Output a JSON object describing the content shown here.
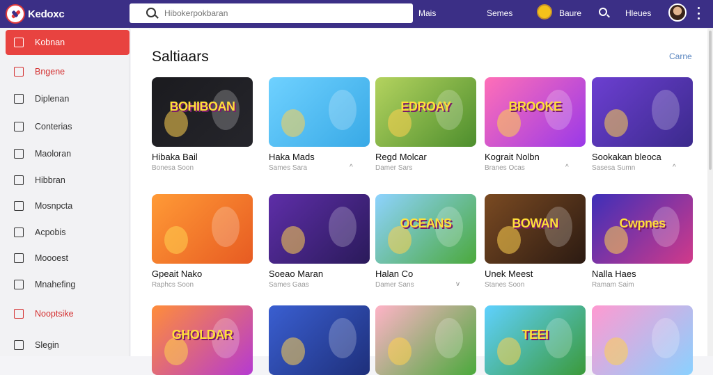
{
  "app": {
    "logo_text": "Kedoxc"
  },
  "search": {
    "placeholder": "Hibokerpokbaran"
  },
  "nav": {
    "link1": "Mais",
    "link2": "Semes",
    "link3": "Baure",
    "link4": "Hleues"
  },
  "sidebar": {
    "items": [
      {
        "label": "Kobnan",
        "icon": "gamepad-icon",
        "state": "active"
      },
      {
        "label": "Bngene",
        "icon": "grid-icon",
        "state": "red"
      },
      {
        "label": "Diplenan",
        "icon": "chat-icon",
        "state": "normal"
      },
      {
        "label": "Conterias",
        "icon": "people-icon",
        "state": "normal"
      },
      {
        "label": "Maoloran",
        "icon": "image-icon",
        "state": "normal"
      },
      {
        "label": "Hibbran",
        "icon": "bag-icon",
        "state": "normal"
      },
      {
        "label": "Mosnpcta",
        "icon": "card-icon",
        "state": "normal"
      },
      {
        "label": "Acpobis",
        "icon": "circle-icon",
        "state": "normal"
      },
      {
        "label": "Moooest",
        "icon": "edit-icon",
        "state": "normal"
      },
      {
        "label": "Mnahefing",
        "icon": "list-icon",
        "state": "normal"
      },
      {
        "label": "Nooptsike",
        "icon": "flag-icon",
        "state": "red"
      },
      {
        "label": "Slegin",
        "icon": "square-icon",
        "state": "normal"
      }
    ]
  },
  "main": {
    "title": "Saltiaars",
    "see_all": "Carne",
    "cards": [
      {
        "title": "Hibaka Bail",
        "sub": "Bonesa Soon",
        "thumb_text": "BOHIBOAN",
        "bg": [
          "#1b1b1f",
          "#25252b"
        ],
        "chev": ""
      },
      {
        "title": "Haka Mads",
        "sub": "Sames Sara",
        "thumb_text": "",
        "bg": [
          "#6fd1ff",
          "#38a9e6"
        ],
        "chev": "^"
      },
      {
        "title": "Regd Molcar",
        "sub": "Damer Sars",
        "thumb_text": "EDROAY",
        "bg": [
          "#b4d35f",
          "#4d8e2d"
        ],
        "chev": ""
      },
      {
        "title": "Kograit Nolbn",
        "sub": "Branes Ocas",
        "thumb_text": "BROOKE",
        "bg": [
          "#ff6fb7",
          "#9a39e8"
        ],
        "chev": "^"
      },
      {
        "title": "Sookakan bleoca",
        "sub": "Sasesa Sumn",
        "thumb_text": "",
        "bg": [
          "#6c3fd1",
          "#3b2a8c"
        ],
        "chev": "^"
      },
      {
        "title": "Gpeait Nako",
        "sub": "Raphcs Soon",
        "thumb_text": "",
        "bg": [
          "#ff9a36",
          "#e75b22"
        ],
        "chev": ""
      },
      {
        "title": "Soeao Maran",
        "sub": "Sames Gaas",
        "thumb_text": "",
        "bg": [
          "#5e2ea8",
          "#2a1a5a"
        ],
        "chev": ""
      },
      {
        "title": "Halan Co",
        "sub": "Damer Sans",
        "thumb_text": "OCEANS",
        "bg": [
          "#8ed3ff",
          "#4ba93c"
        ],
        "chev": "v"
      },
      {
        "title": "Unek Meest",
        "sub": "Stanes Soon",
        "thumb_text": "BOWAN",
        "bg": [
          "#7a4a22",
          "#2b1a12"
        ],
        "chev": ""
      },
      {
        "title": "Nalla Haes",
        "sub": "Ramam Saim",
        "thumb_text": "Cwpnes",
        "bg": [
          "#3e2fb8",
          "#d13a8a"
        ],
        "chev": ""
      },
      {
        "title": "",
        "sub": "",
        "thumb_text": "GHOLDAR",
        "bg": [
          "#ff8d3a",
          "#b53ad1"
        ],
        "chev": ""
      },
      {
        "title": "",
        "sub": "",
        "thumb_text": "",
        "bg": [
          "#3a5fd1",
          "#1e2f7a"
        ],
        "chev": ""
      },
      {
        "title": "",
        "sub": "",
        "thumb_text": "",
        "bg": [
          "#ffb3c7",
          "#4ba93c"
        ],
        "chev": ""
      },
      {
        "title": "",
        "sub": "",
        "thumb_text": "TEEI",
        "bg": [
          "#5fd1ff",
          "#3b9a3a"
        ],
        "chev": ""
      },
      {
        "title": "",
        "sub": "",
        "thumb_text": "",
        "bg": [
          "#ff9ad1",
          "#8ad1ff"
        ],
        "chev": ""
      }
    ]
  }
}
